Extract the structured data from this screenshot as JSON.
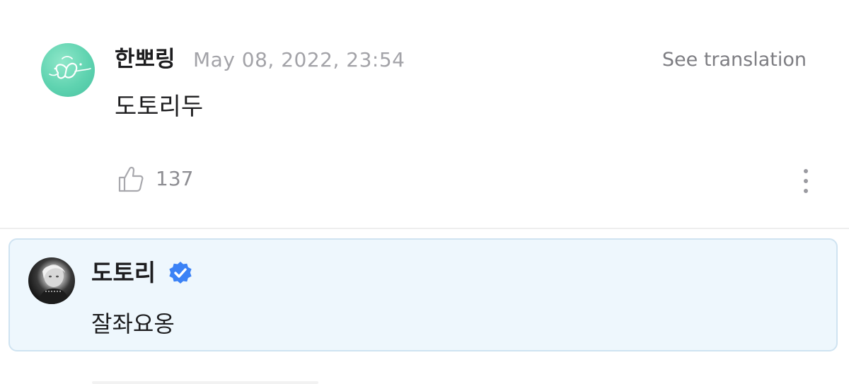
{
  "comment": {
    "author": "한뽀링",
    "timestamp": "May 08, 2022, 23:54",
    "translate_label": "See translation",
    "body": "도토리두",
    "likes": "137",
    "icons": {
      "like": "thumbs-up-icon",
      "more": "more-vertical-icon",
      "avatar": "butterfly-avatar"
    }
  },
  "reply": {
    "author": "도토리",
    "verified": true,
    "body": "잘좌요옹",
    "icons": {
      "badge": "verified-badge-icon",
      "avatar": "artist-avatar"
    }
  },
  "colors": {
    "reply_background": "#eef7fd",
    "reply_border": "#cfe3f1",
    "verified_blue": "#3b82f6",
    "avatar_teal": "#5fd3b0",
    "muted_text": "#a3a3a8"
  }
}
